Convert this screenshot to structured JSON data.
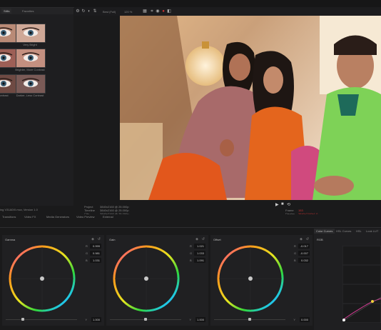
{
  "gallery": {
    "tabs": [
      "Stills",
      "Favorites"
    ],
    "items": [
      {
        "label": "",
        "tint": "#b98a76"
      },
      {
        "label": "Very Bright",
        "tint": "#cfa897"
      },
      {
        "label": "",
        "tint": "#9d5f56"
      },
      {
        "label": "Brighter, More Contrast",
        "tint": "#c49080"
      },
      {
        "label": "Contrast",
        "tint": "#6f4a43"
      },
      {
        "label": "Darker, Less Contrast",
        "tint": "#7a5a56"
      }
    ]
  },
  "toolbar": {
    "zoom_label": "Best (Full)",
    "zoom_pct": "120 %"
  },
  "clip_info": {
    "filename": "ing V31A0IX.mov, Version 1.0",
    "project_label": "Project",
    "project_value": "3840x2160 @ 25.000p",
    "timeline_label": "Timeline",
    "timeline_value": "3840x2160 @ 25.000p",
    "clip_label": "Clip",
    "clip_value": "3840x2160 @ 25.000p",
    "frame_label": "Frame",
    "frame_value": "153",
    "display_label": "Display",
    "display_value": "3840x2160x1.0"
  },
  "bottom_tabs": [
    "Transitions",
    "Video FX",
    "Media Generators",
    "Video Preview",
    "External"
  ],
  "wheels": [
    {
      "title": "Gamma",
      "r": "0.999",
      "g": "0.981",
      "b": "1.031",
      "master": "1.000",
      "knob": 0.24
    },
    {
      "title": "Gain",
      "r": "1.021",
      "g": "1.033",
      "b": "1.091",
      "master": "1.000",
      "knob": 0.5
    },
    {
      "title": "Offset",
      "r": "-0.017",
      "g": "-0.007",
      "b": "0.032",
      "master": "0.000",
      "knob": 0.5
    }
  ],
  "wheel_channels": {
    "r": "R",
    "g": "G",
    "b": "B",
    "y": "Y"
  },
  "curves": {
    "tabs": [
      "Color Curves",
      "HSL Curves",
      "HSL",
      "Look LUT"
    ],
    "title": "RGB"
  },
  "colors": {
    "accent": "#cc3333",
    "curve": "#ffffff"
  }
}
